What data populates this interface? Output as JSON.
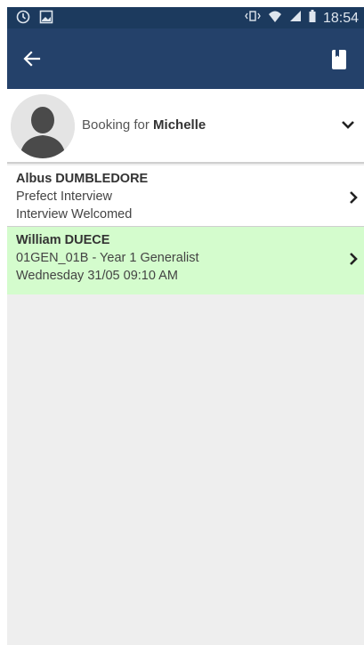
{
  "status_bar": {
    "time": "18:54",
    "icons": [
      "sync-icon",
      "image-icon",
      "vibrate-icon",
      "wifi-icon",
      "signal-icon",
      "battery-icon"
    ]
  },
  "toolbar": {
    "back_icon": "arrow-left-icon",
    "action_icon": "bookmark-icon"
  },
  "booking": {
    "prefix": "Booking for ",
    "name": "Michelle",
    "expand_icon": "chevron-down-icon"
  },
  "interviews": [
    {
      "name": "Albus DUMBLEDORE",
      "line1": "Prefect Interview",
      "line2": "Interview Welcomed",
      "background": "#ffffff"
    },
    {
      "name": "William DUECE",
      "line1": "01GEN_01B - Year 1 Generalist",
      "line2": "Wednesday 31/05 09:10 AM",
      "background": "#d4fccd"
    }
  ],
  "colors": {
    "toolbar": "#24416a",
    "status_bar": "#1c3a5e",
    "selected_row": "#d4fccd",
    "list_background": "#eeeeee"
  }
}
